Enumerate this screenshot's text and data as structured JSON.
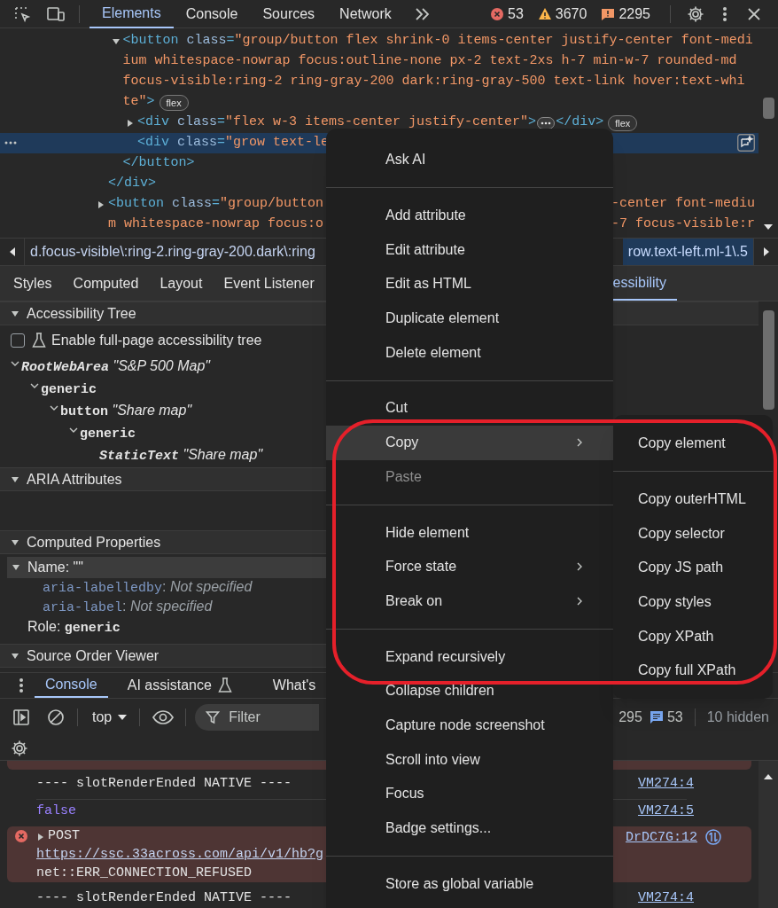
{
  "toolbar": {
    "tabs": [
      {
        "label": "Elements",
        "selected": true
      },
      {
        "label": "Console",
        "selected": false
      },
      {
        "label": "Sources",
        "selected": false
      },
      {
        "label": "Network",
        "selected": false
      }
    ],
    "counts": [
      {
        "kind": "error",
        "text": "53"
      },
      {
        "kind": "warning",
        "text": "3670"
      },
      {
        "kind": "issue",
        "text": "2295"
      }
    ]
  },
  "dom_tree": [
    {
      "close": "</div>",
      "children": [
        {
          "expanded": true,
          "selected": false,
          "badge": "flex",
          "close": "</button>",
          "lines": [
            {
              "segments": [
                {
                  "kind": "tag",
                  "t": "<button"
                },
                {
                  "kind": "attr",
                  "t": " class"
                },
                {
                  "kind": "tag",
                  "t": "="
                },
                {
                  "kind": "value",
                  "t": "\"group/button flex shrink-0 items-center justify-center font-medi"
                }
              ]
            },
            {
              "segments": [
                {
                  "kind": "value",
                  "t": "ium whitespace-nowrap focus:outline-none px-2 text-2xs h-7 min-w-7 rounded-md"
                }
              ]
            },
            {
              "segments": [
                {
                  "kind": "value",
                  "t": "focus-visible:ring-2 ring-gray-200 dark:ring-gray-500 text-link hover:text-whi"
                }
              ]
            },
            {
              "segments": [
                {
                  "kind": "value",
                  "t": "te\""
                },
                {
                  "kind": "tag",
                  "t": ">"
                }
              ]
            }
          ],
          "children": [
            {
              "expanded": false,
              "selected": false,
              "ellipsis": true,
              "badge": "flex",
              "lines": [
                {
                  "segments": [
                    {
                      "kind": "tag",
                      "t": "<div"
                    },
                    {
                      "kind": "attr",
                      "t": " class"
                    },
                    {
                      "kind": "tag",
                      "t": "="
                    },
                    {
                      "kind": "value",
                      "t": "\"flex w-3 items-center justify-center\""
                    },
                    {
                      "kind": "tag",
                      "t": ">"
                    }
                  ],
                  "after": [
                    {
                      "kind": "tag",
                      "t": "</div>"
                    }
                  ]
                }
              ]
            },
            {
              "selected": true,
              "lines": [
                {
                  "segments": [
                    {
                      "kind": "tag",
                      "t": "<div"
                    },
                    {
                      "kind": "attr",
                      "t": " class"
                    },
                    {
                      "kind": "tag",
                      "t": "="
                    },
                    {
                      "kind": "value",
                      "t": "\"grow text-le"
                    }
                  ]
                }
              ]
            }
          ]
        }
      ]
    },
    {
      "expanded": false,
      "selected": false,
      "lines": [
        {
          "segments": [
            {
              "kind": "tag",
              "t": "<button"
            },
            {
              "kind": "attr",
              "t": " class"
            },
            {
              "kind": "tag",
              "t": "="
            },
            {
              "kind": "value",
              "t": "\"group/button"
            }
          ],
          "tail": [
            {
              "kind": "value",
              "t": "-center font-mediu"
            }
          ]
        },
        {
          "segments": [
            {
              "kind": "value",
              "t": "m whitespace-nowrap focus:o"
            }
          ],
          "tail": [
            {
              "kind": "value",
              "t": "-7 focus-visible:r"
            }
          ]
        }
      ]
    }
  ],
  "breadcrumbs": [
    {
      "text": "d.focus-visible\\:ring-2.ring-gray-200.dark\\:ring",
      "selected": false
    },
    {
      "text": "row.text-left.ml-1\\.5",
      "selected": true
    }
  ],
  "panel_tabs_left": [
    {
      "label": "Styles",
      "selected": false
    },
    {
      "label": "Computed",
      "selected": false
    },
    {
      "label": "Layout",
      "selected": false
    },
    {
      "label": "Event Listener",
      "selected": false
    }
  ],
  "panel_tabs_right": [
    {
      "label": "essibility",
      "selected": true
    }
  ],
  "accessibility": {
    "tree_section": {
      "title": "Accessibility Tree",
      "expanded": true
    },
    "checkbox": {
      "label": "Enable full-page accessibility tree",
      "checked": false
    },
    "tree": [
      {
        "role": "RootWebArea",
        "name": "\"S&P 500 Map\"",
        "italic": true,
        "expanded": true,
        "children": [
          {
            "role": "generic",
            "italic": false,
            "expanded": true,
            "children": [
              {
                "role": "button",
                "name": "\"Share map\"",
                "italic": false,
                "expanded": true,
                "children": [
                  {
                    "role": "generic",
                    "italic": false,
                    "expanded": true,
                    "children": [
                      {
                        "role": "StaticText",
                        "name": "\"Share map\"",
                        "italic": true
                      }
                    ]
                  }
                ]
              }
            ]
          }
        ]
      }
    ],
    "aria_section": {
      "title": "ARIA Attributes",
      "expanded": true
    },
    "computed_section": {
      "title": "Computed Properties",
      "expanded": true
    },
    "properties": [
      {
        "label": "Name: ",
        "value": "\"\"",
        "expanded": true,
        "selected": true,
        "children": [
          {
            "key": "aria-labelledby",
            "sep": ": ",
            "value": "Not specified"
          },
          {
            "key": "aria-label",
            "sep": ": ",
            "value": "Not specified"
          }
        ]
      },
      {
        "label": "Role: ",
        "value": "generic",
        "selected": false
      }
    ],
    "source_section": {
      "title": "Source Order Viewer",
      "expanded": true
    }
  },
  "drawer_tabs": [
    {
      "label": "Console",
      "selected": true,
      "kind": "plain"
    },
    {
      "label": "AI assistance",
      "selected": false,
      "kind": "experimental"
    },
    {
      "label": "What's",
      "selected": false,
      "kind": "plain"
    }
  ],
  "console_toolbar": {
    "context": "top",
    "filter_placeholder": "Filter",
    "issues": "295",
    "messages": "53",
    "hidden": "10 hidden"
  },
  "console_messages": [
    {
      "kind": "error_fragment"
    },
    {
      "kind": "log",
      "text": "---- slotRenderEnded NATIVE ----",
      "source": "VM274:4"
    },
    {
      "kind": "value",
      "text": "false",
      "source": "VM274:5"
    },
    {
      "kind": "error",
      "lines": [
        "POST",
        "https://ssc.33across.com/api/v1/hb?g",
        "net::ERR_CONNECTION_REFUSED"
      ],
      "source": "DrDC7G:12"
    },
    {
      "kind": "log",
      "text": "---- slotRenderEnded NATIVE ----",
      "source": "VM274:4"
    }
  ],
  "context_menu": [
    {
      "kind": "item",
      "label": "Ask AI",
      "selected": false,
      "disabled": false,
      "submenu": false
    },
    {
      "kind": "separator"
    },
    {
      "kind": "item",
      "label": "Add attribute",
      "selected": false,
      "disabled": false,
      "submenu": false
    },
    {
      "kind": "item",
      "label": "Edit attribute",
      "selected": false,
      "disabled": false,
      "submenu": false
    },
    {
      "kind": "item",
      "label": "Edit as HTML",
      "selected": false,
      "disabled": false,
      "submenu": false
    },
    {
      "kind": "item",
      "label": "Duplicate element",
      "selected": false,
      "disabled": false,
      "submenu": false
    },
    {
      "kind": "item",
      "label": "Delete element",
      "selected": false,
      "disabled": false,
      "submenu": false
    },
    {
      "kind": "separator"
    },
    {
      "kind": "item",
      "label": "Cut",
      "selected": false,
      "disabled": false,
      "submenu": false
    },
    {
      "kind": "item",
      "label": "Copy",
      "selected": true,
      "disabled": false,
      "submenu": true
    },
    {
      "kind": "item",
      "label": "Paste",
      "selected": false,
      "disabled": true,
      "submenu": false
    },
    {
      "kind": "separator"
    },
    {
      "kind": "item",
      "label": "Hide element",
      "selected": false,
      "disabled": false,
      "submenu": false
    },
    {
      "kind": "item",
      "label": "Force state",
      "selected": false,
      "disabled": false,
      "submenu": true
    },
    {
      "kind": "item",
      "label": "Break on",
      "selected": false,
      "disabled": false,
      "submenu": true
    },
    {
      "kind": "separator"
    },
    {
      "kind": "item",
      "label": "Expand recursively",
      "selected": false,
      "disabled": false,
      "submenu": false
    },
    {
      "kind": "item",
      "label": "Collapse children",
      "selected": false,
      "disabled": false,
      "submenu": false
    },
    {
      "kind": "item",
      "label": "Capture node screenshot",
      "selected": false,
      "disabled": false,
      "submenu": false
    },
    {
      "kind": "item",
      "label": "Scroll into view",
      "selected": false,
      "disabled": false,
      "submenu": false
    },
    {
      "kind": "item",
      "label": "Focus",
      "selected": false,
      "disabled": false,
      "submenu": false
    },
    {
      "kind": "item",
      "label": "Badge settings...",
      "selected": false,
      "disabled": false,
      "submenu": false
    },
    {
      "kind": "separator"
    },
    {
      "kind": "item",
      "label": "Store as global variable",
      "selected": false,
      "disabled": false,
      "submenu": false
    }
  ],
  "copy_submenu": [
    {
      "kind": "item",
      "label": "Copy element",
      "selected": false,
      "disabled": false
    },
    {
      "kind": "separator"
    },
    {
      "kind": "item",
      "label": "Copy outerHTML",
      "selected": false,
      "disabled": false
    },
    {
      "kind": "item",
      "label": "Copy selector",
      "selected": false,
      "disabled": false
    },
    {
      "kind": "item",
      "label": "Copy JS path",
      "selected": false,
      "disabled": false
    },
    {
      "kind": "item",
      "label": "Copy styles",
      "selected": false,
      "disabled": false
    },
    {
      "kind": "item",
      "label": "Copy XPath",
      "selected": false,
      "disabled": false
    },
    {
      "kind": "item",
      "label": "Copy full XPath",
      "selected": false,
      "disabled": false
    }
  ]
}
